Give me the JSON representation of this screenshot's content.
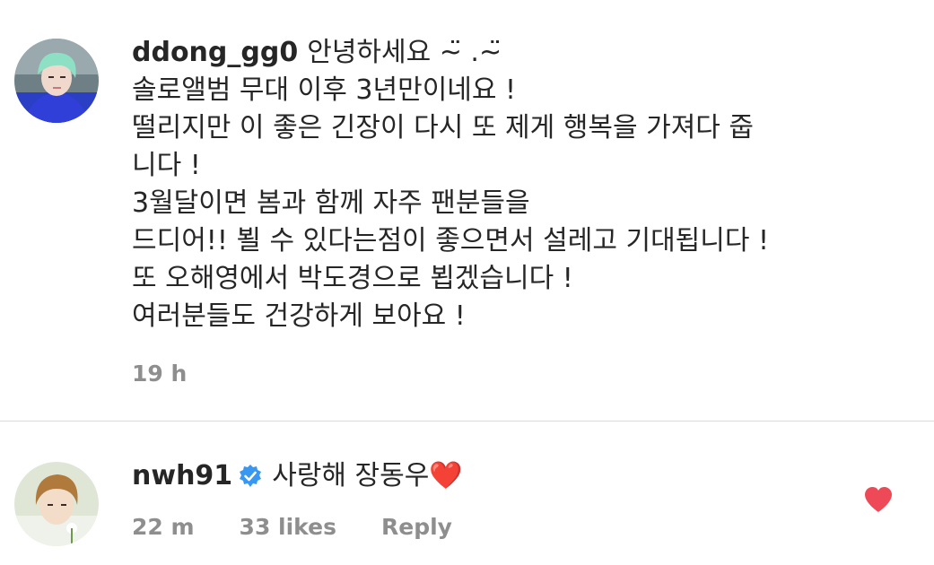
{
  "comment": {
    "username": "ddong_gg0",
    "lines": [
      "안녕하세요 ~̈ .~̈",
      "솔로앨범 무대 이후 3년만이네요 !",
      "떨리지만 이 좋은 긴장이 다시 또 제게 행복을 가져다 줍",
      "니다 !",
      "3월달이면 봄과 함께 자주 팬분들을",
      "드디어!! 뵐 수 있다는점이 좋으면서 설레고 기대됩니다 !",
      "또 오해영에서 박도경으로 뵙겠습니다 !",
      "여러분들도 건강하게 보아요 !"
    ],
    "time": "19 h",
    "avatar_icon": "user-avatar-mint-hair"
  },
  "reply": {
    "username": "nwh91",
    "verified_icon": "verified-badge-icon",
    "text": "사랑해 장동우",
    "emoji": "❤️",
    "time": "22 m",
    "likes": "33 likes",
    "reply_label": "Reply",
    "like_icon": "heart-icon",
    "like_color": "#ed4956",
    "avatar_icon": "user-avatar-brown-hair"
  }
}
